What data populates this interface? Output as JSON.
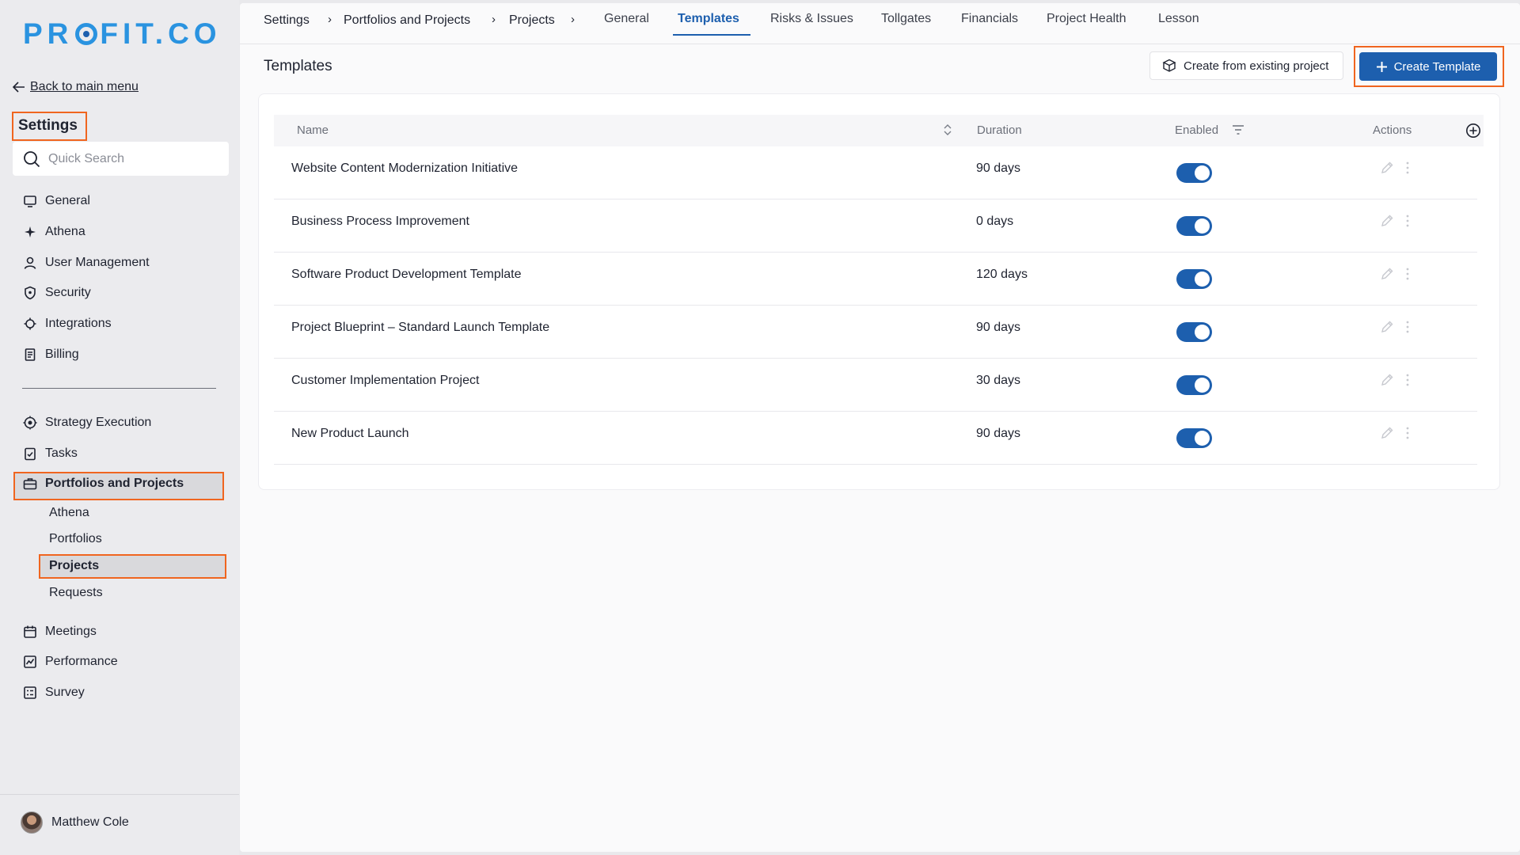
{
  "app": {
    "logo": {
      "left": "PR",
      "right": "FIT.CO"
    }
  },
  "sidebar": {
    "back_label": "Back to main menu",
    "settings_title": "Settings",
    "search_placeholder": "Quick Search",
    "items_top": [
      {
        "label": "General",
        "icon": "monitor-icon"
      },
      {
        "label": "Athena",
        "icon": "sparkle-icon"
      },
      {
        "label": "User Management",
        "icon": "user-icon"
      },
      {
        "label": "Security",
        "icon": "shield-icon"
      },
      {
        "label": "Integrations",
        "icon": "puzzle-icon"
      },
      {
        "label": "Billing",
        "icon": "receipt-icon"
      }
    ],
    "items_mid": [
      {
        "label": "Strategy Execution",
        "icon": "target-icon"
      },
      {
        "label": "Tasks",
        "icon": "checklist-icon"
      },
      {
        "label": "Portfolios and Projects",
        "icon": "briefcase-icon"
      }
    ],
    "sub_items": [
      "Athena",
      "Portfolios",
      "Projects",
      "Requests"
    ],
    "items_bottom": [
      {
        "label": "Meetings",
        "icon": "calendar-icon"
      },
      {
        "label": "Performance",
        "icon": "chart-icon"
      },
      {
        "label": "Survey",
        "icon": "survey-icon"
      }
    ],
    "user_name": "Matthew Cole"
  },
  "breadcrumb": [
    "Settings",
    "Portfolios and Projects",
    "Projects"
  ],
  "breadcrumb_separator": "›",
  "tabs": [
    "General",
    "Templates",
    "Risks & Issues",
    "Tollgates",
    "Financials",
    "Project Health",
    "Lesson"
  ],
  "active_tab": "Templates",
  "page": {
    "title": "Templates",
    "create_from_existing_label": "Create from existing project",
    "create_template_label": "Create Template"
  },
  "table": {
    "headers": {
      "name": "Name",
      "duration": "Duration",
      "enabled": "Enabled",
      "actions": "Actions"
    },
    "rows": [
      {
        "name": "Website Content Modernization Initiative",
        "duration": "90 days",
        "enabled": true
      },
      {
        "name": "Business Process Improvement",
        "duration": "0 days",
        "enabled": true
      },
      {
        "name": "Software Product Development Template",
        "duration": "120 days",
        "enabled": true
      },
      {
        "name": "Project Blueprint – Standard Launch Template",
        "duration": "90 days",
        "enabled": true
      },
      {
        "name": "Customer Implementation Project",
        "duration": "30 days",
        "enabled": true
      },
      {
        "name": "New Product Launch",
        "duration": "90 days",
        "enabled": true
      }
    ]
  },
  "colors": {
    "accent": "#1d5fae",
    "highlight": "#f0651f",
    "logo": "#2a93e0"
  }
}
